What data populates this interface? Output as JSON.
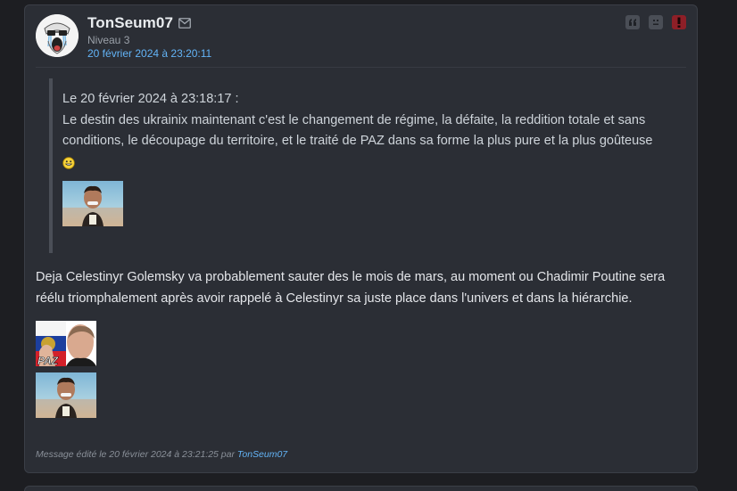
{
  "post": {
    "author": "TonSeum07",
    "level": "Niveau 3",
    "date": "20 février 2024 à 23:20:11",
    "icons": {
      "avatar": "crying-face-avatar",
      "mail": "mail-icon",
      "actions": [
        "quote-icon",
        "ignore-face-icon",
        "report-alert-icon"
      ]
    },
    "quote": {
      "header": "Le 20 février 2024 à 23:18:17 :",
      "text": "Le destin des ukrainix maintenant c'est le changement de régime, la défaite, la reddition totale et sans conditions, le découpage du territoire, et le traité de PAZ dans sa forme la plus pure et la plus goûteuse",
      "emoji": "grinning-smiley-icon",
      "image": "ronaldo-beach-sticker"
    },
    "body": "Deja Celestinyr Golemsky va probablement sauter des le mois de mars, au moment ou Chadimir Poutine sera réélu triomphalement après avoir rappelé à Celestinyr sa juste place dans l'univers et dans la hiérarchie.",
    "stickers": [
      {
        "name": "putin-paz-sticker",
        "text": "PAZ"
      },
      {
        "name": "ronaldo-beach-sticker"
      }
    ],
    "edit": {
      "prefix": "Message édité le 20 février 2024 à 23:21:25 par",
      "user": "TonSeum07"
    }
  },
  "colors": {
    "background": "#1d1e22",
    "card": "#2b2e35",
    "link": "#63b4f7",
    "alert": "#8e1f27"
  }
}
